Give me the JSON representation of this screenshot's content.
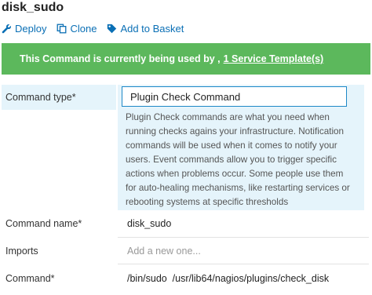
{
  "page": {
    "title": "disk_sudo"
  },
  "actions": {
    "deploy": "Deploy",
    "clone": "Clone",
    "add_to_basket": "Add to Basket"
  },
  "banner": {
    "text": "This Command is currently being used by ,",
    "link": "1 Service Template(s)"
  },
  "form": {
    "command_type": {
      "label": "Command type*",
      "value": "Plugin Check Command",
      "help": "Plugin Check commands are what you need when running checks agains your infrastructure. Notification commands will be used when it comes to notify your users. Event commands allow you to trigger specific actions when problems occur. Some people use them for auto-healing mechanisms, like restarting services or rebooting systems at specific thresholds"
    },
    "command_name": {
      "label": "Command name*",
      "value": "disk_sudo"
    },
    "imports": {
      "label": "Imports",
      "placeholder": "Add a new one..."
    },
    "command": {
      "label": "Command*",
      "value": "/bin/sudo  /usr/lib64/nagios/plugins/check_disk"
    }
  },
  "colors": {
    "banner_bg": "#5cb85c",
    "link": "#0a6fb5",
    "field_focus_border": "#1e88c7",
    "highlight_bg": "#e5f4fb"
  },
  "icons": {
    "deploy": "wrench-icon",
    "clone": "copy-icon",
    "add_to_basket": "tag-icon"
  }
}
